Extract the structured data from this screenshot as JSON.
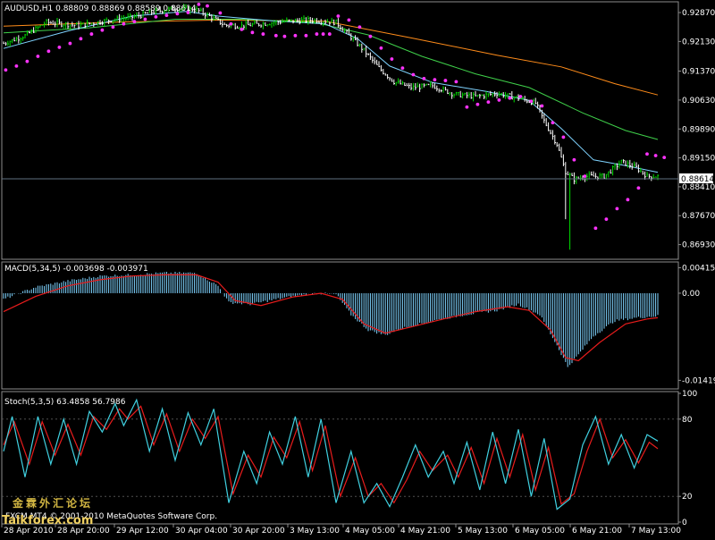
{
  "colors": {
    "background": "#000000",
    "frame": "#8c8c8c",
    "bull_bar": "#00e000",
    "price_line": "#ffffff",
    "sar": "#ff33ff",
    "ma_fast": "#7fd3ff",
    "ma_mid": "#3fd04a",
    "ma_slow": "#ff8c1a",
    "macd_hist": "#7fd3ff",
    "signal": "#e81c1c",
    "stoch_main": "#40d0e0",
    "stoch_signal": "#e81c1c",
    "price_marker_line": "#607080"
  },
  "chart_data": [
    {
      "type": "candlestick",
      "title": "AUDUSD,H1  0.88809 0.88869 0.88589 0.88614",
      "symbol": "AUDUSD,H1",
      "ohlc_header": "0.88809 0.88869 0.88589 0.88614",
      "current_price": "0.88614",
      "ylim": [
        0.866,
        0.931
      ],
      "yticks": [
        "0.92870",
        "0.92130",
        "0.91370",
        "0.90630",
        "0.89890",
        "0.89150",
        "0.88410",
        "0.87670",
        "0.86930"
      ],
      "ytick_values": [
        0.9287,
        0.9213,
        0.9137,
        0.9063,
        0.8989,
        0.8915,
        0.8841,
        0.8767,
        0.8693
      ],
      "xticks": [
        "28 Apr 2010",
        "28 Apr 20:00",
        "29 Apr 12:00",
        "30 Apr 04:00",
        "30 Apr 20:00",
        "3 May 13:00",
        "4 May 05:00",
        "4 May 21:00",
        "5 May 13:00",
        "6 May 05:00",
        "6 May 21:00",
        "7 May 13:00"
      ],
      "close_anchors": [
        [
          0,
          0.9208
        ],
        [
          10,
          0.9228
        ],
        [
          20,
          0.9262
        ],
        [
          35,
          0.9254
        ],
        [
          50,
          0.9268
        ],
        [
          60,
          0.9275
        ],
        [
          70,
          0.9289
        ],
        [
          80,
          0.9298
        ],
        [
          90,
          0.9294
        ],
        [
          97,
          0.9275
        ],
        [
          103,
          0.9255
        ],
        [
          110,
          0.9253
        ],
        [
          120,
          0.9258
        ],
        [
          132,
          0.9265
        ],
        [
          145,
          0.9268
        ],
        [
          155,
          0.9262
        ],
        [
          160,
          0.9235
        ],
        [
          168,
          0.919
        ],
        [
          175,
          0.9145
        ],
        [
          182,
          0.911
        ],
        [
          190,
          0.9095
        ],
        [
          200,
          0.91
        ],
        [
          210,
          0.9078
        ],
        [
          220,
          0.9072
        ],
        [
          230,
          0.908
        ],
        [
          240,
          0.9068
        ],
        [
          248,
          0.9055
        ],
        [
          252,
          0.901
        ],
        [
          258,
          0.895
        ],
        [
          262,
          0.888
        ],
        [
          266,
          0.886
        ],
        [
          272,
          0.8868
        ],
        [
          280,
          0.8868
        ],
        [
          288,
          0.8905
        ],
        [
          295,
          0.889
        ],
        [
          300,
          0.8868
        ]
      ],
      "sar_points": [
        [
          1,
          0.914
        ],
        [
          6,
          0.915
        ],
        [
          11,
          0.9162
        ],
        [
          16,
          0.9175
        ],
        [
          21,
          0.9188
        ],
        [
          26,
          0.9198
        ],
        [
          31,
          0.9208
        ],
        [
          36,
          0.922
        ],
        [
          41,
          0.9232
        ],
        [
          46,
          0.9242
        ],
        [
          51,
          0.925
        ],
        [
          56,
          0.9258
        ],
        [
          61,
          0.9264
        ],
        [
          66,
          0.927
        ],
        [
          71,
          0.9276
        ],
        [
          76,
          0.928
        ],
        [
          81,
          0.9284
        ],
        [
          86,
          0.9287
        ],
        [
          91,
          0.9308
        ],
        [
          95,
          0.9304
        ],
        [
          101,
          0.9286
        ],
        [
          106,
          0.9258
        ],
        [
          111,
          0.9244
        ],
        [
          116,
          0.9236
        ],
        [
          121,
          0.9232
        ],
        [
          127,
          0.9228
        ],
        [
          131,
          0.9226
        ],
        [
          136,
          0.9228
        ],
        [
          141,
          0.9228
        ],
        [
          146,
          0.9232
        ],
        [
          149,
          0.9232
        ],
        [
          152,
          0.9232
        ],
        [
          156,
          0.9278
        ],
        [
          161,
          0.9268
        ],
        [
          166,
          0.925
        ],
        [
          171,
          0.9226
        ],
        [
          176,
          0.9196
        ],
        [
          181,
          0.9168
        ],
        [
          186,
          0.9145
        ],
        [
          191,
          0.9128
        ],
        [
          196,
          0.9118
        ],
        [
          201,
          0.9115
        ],
        [
          206,
          0.9113
        ],
        [
          211,
          0.911
        ],
        [
          216,
          0.9045
        ],
        [
          221,
          0.9052
        ],
        [
          226,
          0.9058
        ],
        [
          231,
          0.9063
        ],
        [
          236,
          0.9068
        ],
        [
          241,
          0.9072
        ],
        [
          246,
          0.906
        ],
        [
          251,
          0.9048
        ],
        [
          256,
          0.9005
        ],
        [
          261,
          0.8968
        ],
        [
          266,
          0.891
        ],
        [
          271,
          0.8868
        ],
        [
          276,
          0.8735
        ],
        [
          281,
          0.8758
        ],
        [
          286,
          0.8785
        ],
        [
          291,
          0.8808
        ],
        [
          296,
          0.8838
        ],
        [
          300,
          0.8925
        ],
        [
          304,
          0.8921
        ],
        [
          308,
          0.8916
        ]
      ],
      "ma_fast": [
        [
          0,
          0.9195
        ],
        [
          30,
          0.924
        ],
        [
          60,
          0.9278
        ],
        [
          85,
          0.929
        ],
        [
          100,
          0.9278
        ],
        [
          125,
          0.9266
        ],
        [
          150,
          0.9258
        ],
        [
          165,
          0.922
        ],
        [
          180,
          0.915
        ],
        [
          200,
          0.9108
        ],
        [
          225,
          0.9085
        ],
        [
          245,
          0.9062
        ],
        [
          260,
          0.899
        ],
        [
          275,
          0.891
        ],
        [
          290,
          0.8895
        ],
        [
          305,
          0.8878
        ]
      ],
      "ma_mid": [
        [
          0,
          0.9235
        ],
        [
          40,
          0.9248
        ],
        [
          80,
          0.927
        ],
        [
          110,
          0.927
        ],
        [
          145,
          0.9262
        ],
        [
          170,
          0.923
        ],
        [
          195,
          0.9175
        ],
        [
          220,
          0.913
        ],
        [
          245,
          0.9095
        ],
        [
          270,
          0.903
        ],
        [
          290,
          0.8985
        ],
        [
          305,
          0.8962
        ]
      ],
      "ma_slow": [
        [
          0,
          0.9252
        ],
        [
          50,
          0.9262
        ],
        [
          100,
          0.9268
        ],
        [
          150,
          0.9265
        ],
        [
          190,
          0.9222
        ],
        [
          230,
          0.9178
        ],
        [
          260,
          0.9148
        ],
        [
          285,
          0.9105
        ],
        [
          305,
          0.9076
        ]
      ]
    },
    {
      "type": "bar",
      "title": "MACD(5,34,5) -0.003698 -0.003971",
      "label": "MACD(5,34,5)",
      "values_header": "-0.003698 -0.003971",
      "ylim": [
        -0.0153,
        0.0048
      ],
      "yticks": [
        "0.004157",
        "0.00",
        "-0.01419"
      ],
      "ytick_values": [
        0.004157,
        0.0,
        -0.01419
      ],
      "hist_anchors": [
        [
          0,
          -0.001
        ],
        [
          15,
          0.001
        ],
        [
          30,
          0.002
        ],
        [
          45,
          0.0028
        ],
        [
          60,
          0.003
        ],
        [
          75,
          0.0033
        ],
        [
          90,
          0.0033
        ],
        [
          100,
          0.0012
        ],
        [
          105,
          -0.0015
        ],
        [
          115,
          -0.0018
        ],
        [
          130,
          -0.0008
        ],
        [
          145,
          0.0
        ],
        [
          155,
          -0.0002
        ],
        [
          162,
          -0.0035
        ],
        [
          170,
          -0.006
        ],
        [
          178,
          -0.0068
        ],
        [
          185,
          -0.0058
        ],
        [
          200,
          -0.0045
        ],
        [
          215,
          -0.0035
        ],
        [
          230,
          -0.0028
        ],
        [
          240,
          -0.0018
        ],
        [
          250,
          -0.0035
        ],
        [
          258,
          -0.0085
        ],
        [
          263,
          -0.012
        ],
        [
          268,
          -0.01
        ],
        [
          275,
          -0.007
        ],
        [
          285,
          -0.0045
        ],
        [
          295,
          -0.004
        ],
        [
          305,
          -0.0037
        ]
      ],
      "signal_anchors": [
        [
          0,
          -0.003
        ],
        [
          15,
          -0.0005
        ],
        [
          30,
          0.0012
        ],
        [
          45,
          0.0022
        ],
        [
          60,
          0.0028
        ],
        [
          75,
          0.003
        ],
        [
          90,
          0.003
        ],
        [
          100,
          0.0018
        ],
        [
          108,
          -0.0012
        ],
        [
          120,
          -0.002
        ],
        [
          135,
          -0.0006
        ],
        [
          148,
          0.0
        ],
        [
          158,
          -0.001
        ],
        [
          168,
          -0.005
        ],
        [
          178,
          -0.0065
        ],
        [
          190,
          -0.0055
        ],
        [
          205,
          -0.0042
        ],
        [
          220,
          -0.003
        ],
        [
          235,
          -0.0022
        ],
        [
          245,
          -0.0028
        ],
        [
          255,
          -0.006
        ],
        [
          262,
          -0.0105
        ],
        [
          268,
          -0.011
        ],
        [
          278,
          -0.008
        ],
        [
          290,
          -0.005
        ],
        [
          300,
          -0.0042
        ],
        [
          305,
          -0.004
        ]
      ]
    },
    {
      "type": "line",
      "title": "Stoch(5,3,5) 63.4858 56.7986",
      "label": "Stoch(5,3,5)",
      "values_header": "63.4858 56.7986",
      "ylim": [
        0,
        100
      ],
      "yticks": [
        "100",
        "80",
        "20",
        "0"
      ],
      "ytick_values": [
        100,
        80,
        20,
        0
      ],
      "main_anchors": [
        [
          0,
          55
        ],
        [
          4,
          82
        ],
        [
          10,
          35
        ],
        [
          16,
          82
        ],
        [
          22,
          45
        ],
        [
          28,
          80
        ],
        [
          34,
          45
        ],
        [
          40,
          86
        ],
        [
          46,
          70
        ],
        [
          52,
          92
        ],
        [
          56,
          75
        ],
        [
          62,
          95
        ],
        [
          68,
          55
        ],
        [
          74,
          88
        ],
        [
          80,
          48
        ],
        [
          86,
          85
        ],
        [
          92,
          60
        ],
        [
          98,
          88
        ],
        [
          105,
          15
        ],
        [
          112,
          55
        ],
        [
          118,
          30
        ],
        [
          124,
          70
        ],
        [
          130,
          45
        ],
        [
          136,
          82
        ],
        [
          142,
          35
        ],
        [
          148,
          80
        ],
        [
          155,
          15
        ],
        [
          162,
          55
        ],
        [
          168,
          15
        ],
        [
          174,
          30
        ],
        [
          180,
          12
        ],
        [
          186,
          35
        ],
        [
          192,
          60
        ],
        [
          198,
          35
        ],
        [
          205,
          55
        ],
        [
          210,
          30
        ],
        [
          216,
          62
        ],
        [
          222,
          25
        ],
        [
          228,
          70
        ],
        [
          234,
          30
        ],
        [
          240,
          72
        ],
        [
          246,
          20
        ],
        [
          252,
          65
        ],
        [
          258,
          10
        ],
        [
          264,
          18
        ],
        [
          270,
          60
        ],
        [
          276,
          82
        ],
        [
          282,
          45
        ],
        [
          288,
          68
        ],
        [
          294,
          42
        ],
        [
          300,
          68
        ],
        [
          305,
          63
        ]
      ],
      "signal_anchors": [
        [
          0,
          60
        ],
        [
          5,
          78
        ],
        [
          12,
          45
        ],
        [
          18,
          78
        ],
        [
          24,
          52
        ],
        [
          30,
          76
        ],
        [
          36,
          52
        ],
        [
          42,
          82
        ],
        [
          48,
          72
        ],
        [
          54,
          88
        ],
        [
          58,
          80
        ],
        [
          64,
          90
        ],
        [
          70,
          60
        ],
        [
          76,
          84
        ],
        [
          82,
          55
        ],
        [
          88,
          80
        ],
        [
          94,
          65
        ],
        [
          100,
          82
        ],
        [
          107,
          22
        ],
        [
          114,
          52
        ],
        [
          120,
          35
        ],
        [
          126,
          66
        ],
        [
          132,
          50
        ],
        [
          138,
          78
        ],
        [
          144,
          40
        ],
        [
          150,
          75
        ],
        [
          157,
          20
        ],
        [
          164,
          50
        ],
        [
          170,
          20
        ],
        [
          176,
          30
        ],
        [
          182,
          15
        ],
        [
          188,
          33
        ],
        [
          194,
          55
        ],
        [
          200,
          40
        ],
        [
          207,
          52
        ],
        [
          212,
          35
        ],
        [
          218,
          58
        ],
        [
          224,
          30
        ],
        [
          230,
          65
        ],
        [
          236,
          35
        ],
        [
          242,
          68
        ],
        [
          248,
          25
        ],
        [
          254,
          58
        ],
        [
          260,
          14
        ],
        [
          266,
          22
        ],
        [
          272,
          55
        ],
        [
          278,
          80
        ],
        [
          284,
          50
        ],
        [
          290,
          64
        ],
        [
          296,
          46
        ],
        [
          301,
          62
        ],
        [
          305,
          57
        ]
      ]
    }
  ],
  "watermark": {
    "copyright": "FXCM MT4 © 2001-2010 MetaQuotes Software Corp.",
    "site_cn": "金霖外汇论坛",
    "site": "Talkforex.com"
  }
}
